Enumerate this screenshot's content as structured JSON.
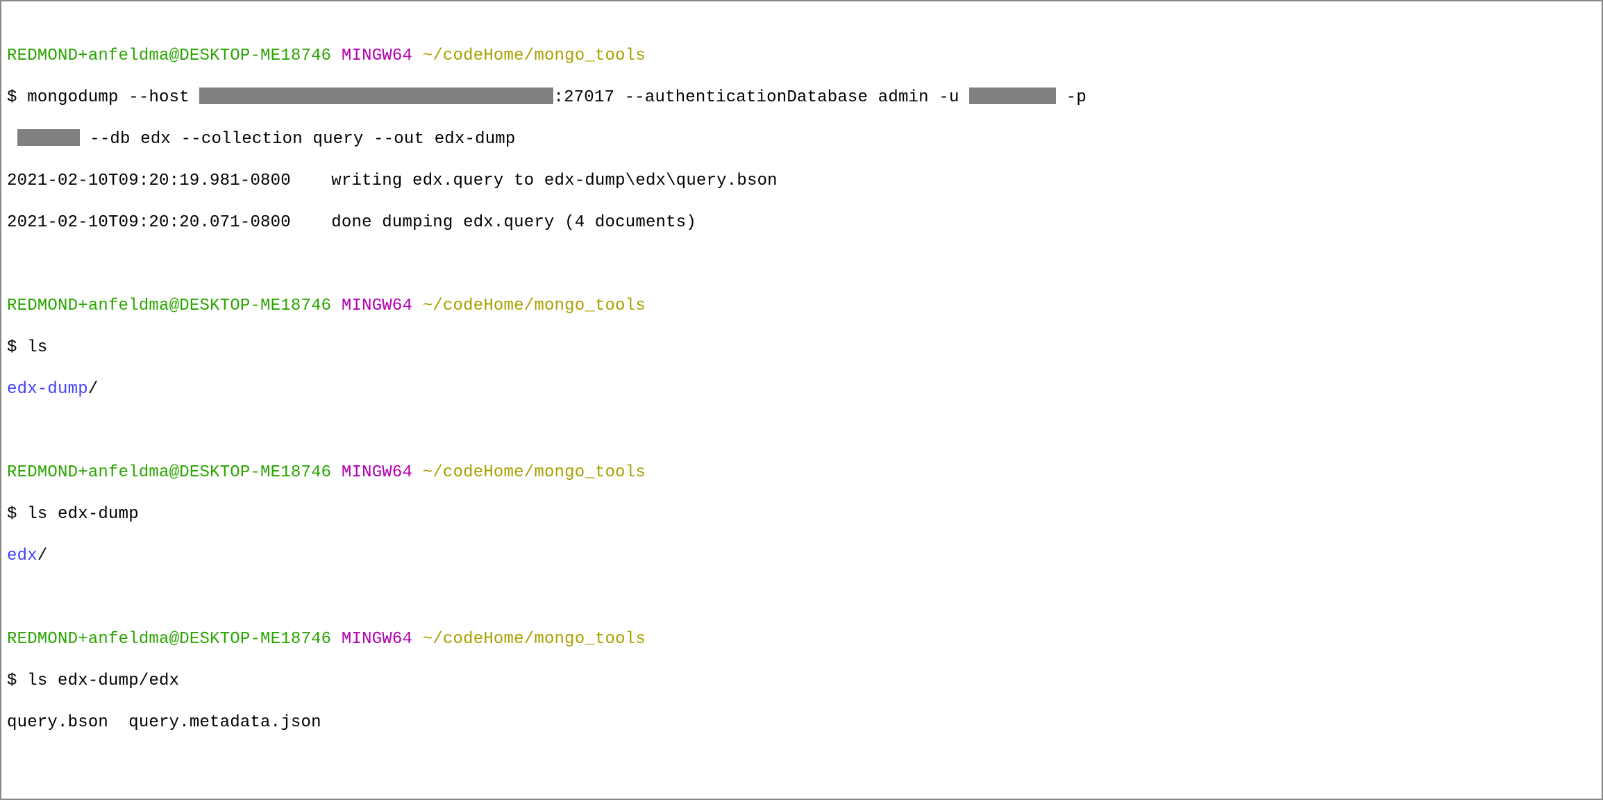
{
  "prompt_header": {
    "user_host": "REDMOND+anfeldma@DESKTOP-ME18746",
    "shell": "MINGW64",
    "path": "~/codeHome/mongo_tools"
  },
  "block1": {
    "ps": "$ ",
    "cmd_part1": "mongodump --host ",
    "cmd_part2": ":27017 --authenticationDatabase admin -u ",
    "cmd_part3": " -p",
    "cmd_line2_pre": " ",
    "cmd_line2": " --db edx --collection query --out edx-dump",
    "out1": "2021-02-10T09:20:19.981-0800    writing edx.query to edx-dump\\edx\\query.bson",
    "out2": "2021-02-10T09:20:20.071-0800    done dumping edx.query (4 documents)"
  },
  "block2": {
    "ps": "$ ",
    "cmd": "ls",
    "out_dir": "edx-dump",
    "out_slash": "/"
  },
  "block3": {
    "ps": "$ ",
    "cmd": "ls edx-dump",
    "out_dir": "edx",
    "out_slash": "/"
  },
  "block4": {
    "ps": "$ ",
    "cmd": "ls edx-dump/edx",
    "out": "query.bson  query.metadata.json"
  }
}
